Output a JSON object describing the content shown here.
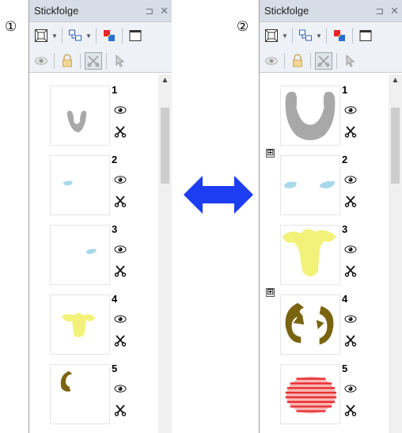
{
  "markers": {
    "left": "①",
    "right": "②"
  },
  "panel": {
    "title": "Stickfolge",
    "pin_glyph": "⊐",
    "close_glyph": "✕",
    "scroll_up_glyph": "▲"
  },
  "left_panel": {
    "items": [
      {
        "number": "1",
        "thumb": "v-gray-small"
      },
      {
        "number": "2",
        "thumb": "blue-one"
      },
      {
        "number": "3",
        "thumb": "blue-two"
      },
      {
        "number": "4",
        "thumb": "yellow-small"
      },
      {
        "number": "5",
        "thumb": "brown-c"
      }
    ]
  },
  "right_panel": {
    "items": [
      {
        "number": "1",
        "thumb": "v-gray-large"
      },
      {
        "number": "2",
        "thumb": "blue-pair",
        "expander": "⊞"
      },
      {
        "number": "3",
        "thumb": "yellow-large"
      },
      {
        "number": "4",
        "thumb": "brown-brackets",
        "expander": "⊞"
      },
      {
        "number": "5",
        "thumb": "red-ball"
      }
    ]
  },
  "colors": {
    "gray": "#a8a8a8",
    "light_blue": "#a8d8ea",
    "yellow": "#f2f27a",
    "brown": "#7a6410",
    "red": "#e83030",
    "arrow_blue": "#1c3df2"
  },
  "icons": [
    "frame-icon",
    "order-icon",
    "color-icon",
    "window-icon",
    "eye-icon",
    "lock-icon",
    "scissors-icon",
    "pointer-icon"
  ]
}
